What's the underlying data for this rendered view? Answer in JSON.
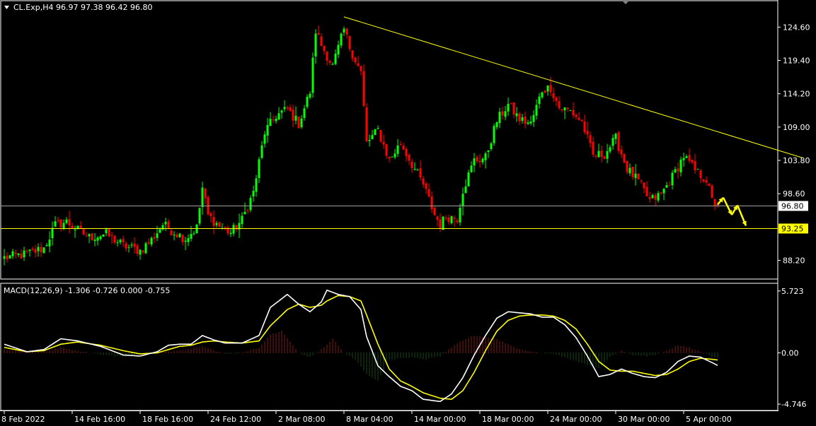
{
  "header": {
    "symbol_line": "CL.Exp,H4  96.97 97.38 96.42 96.80",
    "macd_line": "MACD(12,26,9) -1.306 -0.726 0.000 -0.755"
  },
  "colors": {
    "background": "#000000",
    "bull": "#00ff00",
    "bear": "#ff0000",
    "trendline": "#ffff00",
    "support": "#ffff00",
    "macd": "#ffffff",
    "signal": "#ffff00",
    "hist_pos": "#ff3030",
    "hist_neg": "#2e8b2e",
    "grid_frame": "#ffffff"
  },
  "chart_data": [
    {
      "type": "candlestick",
      "title": "CL.Exp,H4",
      "ohlc_last": {
        "open": 96.97,
        "high": 97.38,
        "low": 96.42,
        "close": 96.8
      },
      "ylim": [
        85.5,
        128.5
      ],
      "y_ticks": [
        "124.60",
        "119.40",
        "114.20",
        "109.00",
        "103.80",
        "98.60",
        "88.20"
      ],
      "y_tick_values": [
        124.6,
        119.4,
        114.2,
        109.0,
        103.8,
        98.6,
        88.2
      ],
      "x_ticks": [
        "8 Feb 2022",
        "14 Feb 16:00",
        "18 Feb 16:00",
        "24 Feb 12:00",
        "2 Mar 08:00",
        "8 Mar 04:00",
        "14 Mar 00:00",
        "18 Mar 00:00",
        "24 Mar 00:00",
        "30 Mar 00:00",
        "5 Apr 00:00"
      ],
      "x_tick_indices": [
        0,
        24,
        48,
        72,
        96,
        120,
        144,
        168,
        192,
        216,
        240
      ],
      "num_bars": 253,
      "close_path": [
        [
          0,
          88.6
        ],
        [
          8,
          89.2
        ],
        [
          14,
          90.1
        ],
        [
          18,
          93.7
        ],
        [
          22,
          94.2
        ],
        [
          26,
          92.9
        ],
        [
          30,
          91.8
        ],
        [
          36,
          92.3
        ],
        [
          42,
          90.5
        ],
        [
          48,
          89.7
        ],
        [
          52,
          91.4
        ],
        [
          56,
          93.8
        ],
        [
          60,
          92.6
        ],
        [
          64,
          91.6
        ],
        [
          68,
          93.3
        ],
        [
          70,
          99.5
        ],
        [
          72,
          95.2
        ],
        [
          76,
          93.5
        ],
        [
          80,
          92.5
        ],
        [
          84,
          94.5
        ],
        [
          88,
          98.8
        ],
        [
          92,
          108.2
        ],
        [
          96,
          110.8
        ],
        [
          100,
          111.8
        ],
        [
          104,
          109.5
        ],
        [
          108,
          114.5
        ],
        [
          110,
          124.0
        ],
        [
          112,
          121.8
        ],
        [
          116,
          118.5
        ],
        [
          120,
          124.2
        ],
        [
          122,
          121.5
        ],
        [
          126,
          117.5
        ],
        [
          128,
          106.5
        ],
        [
          132,
          108.5
        ],
        [
          136,
          103.8
        ],
        [
          140,
          106.5
        ],
        [
          144,
          103.2
        ],
        [
          148,
          100.0
        ],
        [
          152,
          95.3
        ],
        [
          154,
          93.8
        ],
        [
          156,
          95.0
        ],
        [
          160,
          94.8
        ],
        [
          162,
          99.2
        ],
        [
          166,
          103.8
        ],
        [
          170,
          104.2
        ],
        [
          174,
          110.0
        ],
        [
          178,
          112.5
        ],
        [
          182,
          110.2
        ],
        [
          186,
          109.5
        ],
        [
          190,
          114.8
        ],
        [
          193,
          115.2
        ],
        [
          196,
          112.0
        ],
        [
          200,
          111.5
        ],
        [
          204,
          109.8
        ],
        [
          208,
          104.5
        ],
        [
          212,
          104.8
        ],
        [
          216,
          107.2
        ],
        [
          220,
          102.5
        ],
        [
          224,
          100.5
        ],
        [
          228,
          97.5
        ],
        [
          232,
          98.5
        ],
        [
          236,
          101.2
        ],
        [
          240,
          104.5
        ],
        [
          244,
          102.2
        ],
        [
          248,
          100.8
        ],
        [
          250,
          97.5
        ],
        [
          252,
          96.8
        ]
      ],
      "trendline": {
        "from": [
          120,
          126.2
        ],
        "to": [
          282,
          104.2
        ]
      },
      "horizontal_lines": [
        {
          "value": 96.8,
          "label": "96.80",
          "kind": "current_price"
        },
        {
          "value": 93.25,
          "label": "93.25",
          "kind": "support"
        }
      ],
      "projection_arrows": [
        [
          [
            252,
            96.9
          ],
          [
            254,
            98.0
          ]
        ],
        [
          [
            254,
            98.0
          ],
          [
            257,
            95.3
          ]
        ],
        [
          [
            257,
            95.3
          ],
          [
            259,
            96.8
          ]
        ],
        [
          [
            259,
            96.8
          ],
          [
            262,
            93.6
          ]
        ]
      ]
    },
    {
      "type": "line",
      "title": "MACD(12,26,9)",
      "values_last": {
        "macd": -1.306,
        "signal": -0.726,
        "level": 0.0,
        "histogram": -0.755
      },
      "ylim": [
        -5.2,
        6.3
      ],
      "y_ticks": [
        "5.723",
        "0.00",
        "-4.746"
      ],
      "y_tick_values": [
        5.723,
        0.0,
        -4.746
      ],
      "series": [
        {
          "name": "MACD",
          "points": [
            [
              0,
              0.8
            ],
            [
              8,
              0.1
            ],
            [
              14,
              0.3
            ],
            [
              20,
              1.3
            ],
            [
              26,
              1.1
            ],
            [
              34,
              0.6
            ],
            [
              42,
              -0.2
            ],
            [
              48,
              -0.3
            ],
            [
              54,
              0.1
            ],
            [
              58,
              0.7
            ],
            [
              62,
              0.8
            ],
            [
              66,
              0.8
            ],
            [
              70,
              1.6
            ],
            [
              74,
              1.2
            ],
            [
              78,
              0.9
            ],
            [
              84,
              0.9
            ],
            [
              90,
              1.6
            ],
            [
              94,
              4.2
            ],
            [
              100,
              5.4
            ],
            [
              104,
              4.5
            ],
            [
              108,
              3.8
            ],
            [
              112,
              4.7
            ],
            [
              114,
              5.8
            ],
            [
              118,
              5.4
            ],
            [
              122,
              5.2
            ],
            [
              126,
              4.0
            ],
            [
              128,
              1.5
            ],
            [
              132,
              -1.2
            ],
            [
              136,
              -2.2
            ],
            [
              140,
              -3.1
            ],
            [
              144,
              -3.5
            ],
            [
              148,
              -4.3
            ],
            [
              154,
              -4.5
            ],
            [
              158,
              -3.8
            ],
            [
              162,
              -2.3
            ],
            [
              166,
              -0.2
            ],
            [
              170,
              1.6
            ],
            [
              174,
              3.2
            ],
            [
              178,
              3.8
            ],
            [
              182,
              3.7
            ],
            [
              186,
              3.6
            ],
            [
              190,
              3.3
            ],
            [
              194,
              3.3
            ],
            [
              198,
              2.6
            ],
            [
              202,
              1.4
            ],
            [
              206,
              -0.3
            ],
            [
              210,
              -2.2
            ],
            [
              214,
              -2.0
            ],
            [
              218,
              -1.5
            ],
            [
              222,
              -1.9
            ],
            [
              226,
              -2.2
            ],
            [
              230,
              -2.3
            ],
            [
              234,
              -1.8
            ],
            [
              238,
              -0.8
            ],
            [
              242,
              -0.3
            ],
            [
              246,
              -0.4
            ],
            [
              250,
              -0.9
            ],
            [
              253,
              -1.3
            ]
          ]
        },
        {
          "name": "Signal",
          "points": [
            [
              0,
              0.5
            ],
            [
              8,
              0.1
            ],
            [
              14,
              0.2
            ],
            [
              20,
              0.8
            ],
            [
              26,
              1.0
            ],
            [
              34,
              0.7
            ],
            [
              42,
              0.2
            ],
            [
              48,
              -0.1
            ],
            [
              54,
              0.0
            ],
            [
              58,
              0.3
            ],
            [
              62,
              0.6
            ],
            [
              66,
              0.7
            ],
            [
              70,
              1.0
            ],
            [
              74,
              1.1
            ],
            [
              78,
              1.0
            ],
            [
              84,
              0.9
            ],
            [
              90,
              1.1
            ],
            [
              94,
              2.5
            ],
            [
              100,
              4.0
            ],
            [
              104,
              4.5
            ],
            [
              108,
              4.2
            ],
            [
              112,
              4.4
            ],
            [
              114,
              4.8
            ],
            [
              118,
              5.3
            ],
            [
              122,
              5.2
            ],
            [
              126,
              4.8
            ],
            [
              128,
              3.5
            ],
            [
              132,
              0.8
            ],
            [
              136,
              -1.5
            ],
            [
              140,
              -2.6
            ],
            [
              144,
              -3.1
            ],
            [
              148,
              -3.7
            ],
            [
              154,
              -4.2
            ],
            [
              158,
              -4.3
            ],
            [
              162,
              -3.5
            ],
            [
              166,
              -1.8
            ],
            [
              170,
              0.2
            ],
            [
              174,
              2.0
            ],
            [
              178,
              3.0
            ],
            [
              182,
              3.4
            ],
            [
              186,
              3.5
            ],
            [
              190,
              3.5
            ],
            [
              194,
              3.4
            ],
            [
              198,
              3.0
            ],
            [
              202,
              2.2
            ],
            [
              206,
              0.8
            ],
            [
              210,
              -0.8
            ],
            [
              214,
              -1.6
            ],
            [
              218,
              -1.7
            ],
            [
              222,
              -1.7
            ],
            [
              226,
              -1.9
            ],
            [
              230,
              -2.1
            ],
            [
              234,
              -2.0
            ],
            [
              238,
              -1.5
            ],
            [
              242,
              -0.8
            ],
            [
              246,
              -0.5
            ],
            [
              250,
              -0.6
            ],
            [
              253,
              -0.7
            ]
          ]
        },
        {
          "name": "Histogram",
          "points": [
            [
              0,
              0.3
            ],
            [
              14,
              0.1
            ],
            [
              20,
              0.5
            ],
            [
              30,
              0.0
            ],
            [
              42,
              -0.4
            ],
            [
              54,
              0.1
            ],
            [
              62,
              0.2
            ],
            [
              70,
              0.6
            ],
            [
              78,
              -0.1
            ],
            [
              84,
              0.0
            ],
            [
              90,
              0.5
            ],
            [
              94,
              1.7
            ],
            [
              98,
              2.0
            ],
            [
              104,
              0.0
            ],
            [
              108,
              -0.4
            ],
            [
              112,
              0.3
            ],
            [
              116,
              1.3
            ],
            [
              120,
              0.0
            ],
            [
              124,
              -0.6
            ],
            [
              128,
              -2.0
            ],
            [
              132,
              -2.6
            ],
            [
              136,
              -0.7
            ],
            [
              140,
              -0.5
            ],
            [
              144,
              -0.4
            ],
            [
              148,
              -0.6
            ],
            [
              154,
              -0.3
            ],
            [
              158,
              0.5
            ],
            [
              162,
              1.2
            ],
            [
              166,
              1.6
            ],
            [
              170,
              1.4
            ],
            [
              174,
              1.2
            ],
            [
              178,
              0.8
            ],
            [
              182,
              0.3
            ],
            [
              186,
              0.1
            ],
            [
              194,
              -0.1
            ],
            [
              198,
              -0.4
            ],
            [
              202,
              -0.8
            ],
            [
              206,
              -1.1
            ],
            [
              210,
              -1.4
            ],
            [
              214,
              -0.4
            ],
            [
              218,
              0.2
            ],
            [
              222,
              -0.2
            ],
            [
              226,
              -0.3
            ],
            [
              230,
              -0.2
            ],
            [
              234,
              0.2
            ],
            [
              238,
              0.7
            ],
            [
              242,
              0.5
            ],
            [
              246,
              0.1
            ],
            [
              250,
              -0.3
            ],
            [
              253,
              -0.6
            ]
          ]
        }
      ]
    }
  ]
}
